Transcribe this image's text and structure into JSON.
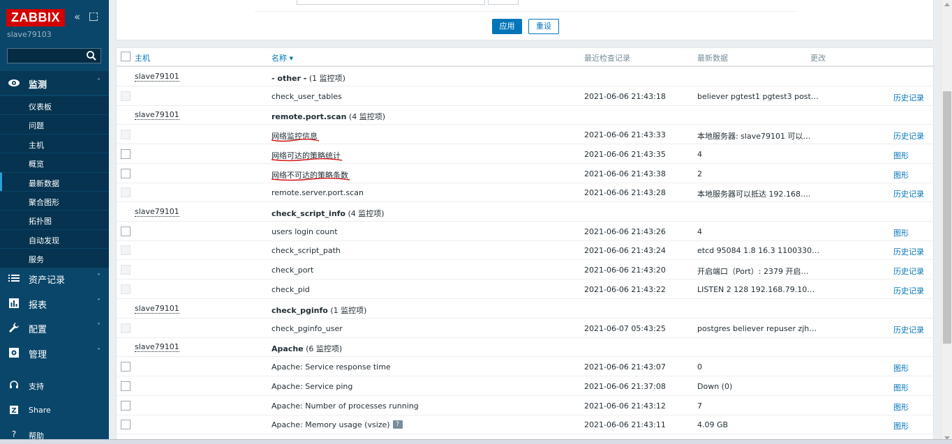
{
  "sidebar": {
    "logo": "ZABBIX",
    "server_name": "slave79103",
    "search_placeholder": "",
    "sections": [
      {
        "label": "监测",
        "icon": "eye-icon"
      },
      {
        "label": "资产记录",
        "icon": "list-icon"
      },
      {
        "label": "报表",
        "icon": "bar-chart-icon"
      },
      {
        "label": "配置",
        "icon": "wrench-icon"
      },
      {
        "label": "管理",
        "icon": "gear-icon"
      }
    ],
    "monitoring_items": [
      "仪表板",
      "问题",
      "主机",
      "概览",
      "最新数据",
      "聚合图形",
      "拓扑图",
      "自动发现",
      "服务"
    ],
    "selected_item": "最新数据",
    "footer": [
      {
        "label": "支持",
        "icon": "headset-icon"
      },
      {
        "label": "Share",
        "icon": "share-icon"
      },
      {
        "label": "帮助",
        "icon": "help-icon"
      }
    ]
  },
  "filter": {
    "apply_label": "应用",
    "reset_label": "重设"
  },
  "table": {
    "columns": {
      "host": "主机",
      "name": "名称 ▾",
      "last_check": "最近检查记录",
      "last_value": "最新数据",
      "change": "更改"
    },
    "rows": [
      {
        "type": "group",
        "host": "slave79101",
        "group_name": "- other -",
        "group_count": " (1 监控项)"
      },
      {
        "type": "item",
        "name": "check_user_tables",
        "last_check": "2021-06-06 21:43:18",
        "last_value": "believer pgtest1 pgtest3 post…",
        "link": "历史记录",
        "cb_disabled": true
      },
      {
        "type": "group",
        "host": "slave79101",
        "group_name": "remote.port.scan",
        "group_count": " (4 监控项)"
      },
      {
        "type": "item",
        "name": "网络监控信息",
        "last_check": "2021-06-06 21:43:33",
        "last_value": "本地服务器: slave79101 可以…",
        "link": "历史记录",
        "cb_disabled": true,
        "underline": true
      },
      {
        "type": "item",
        "name": "网络可达的策略统计",
        "last_check": "2021-06-06 21:43:35",
        "last_value": "4",
        "link": "图形",
        "cb_disabled": false,
        "underline": true
      },
      {
        "type": "item",
        "name": "网络不可达的策略条数",
        "last_check": "2021-06-06 21:43:38",
        "last_value": "2",
        "link": "图形",
        "cb_disabled": false,
        "underline": true
      },
      {
        "type": "item",
        "name": "remote.server.port.scan",
        "last_check": "2021-06-06 21:43:28",
        "last_value": "本地服务器可以抵达 192.168.…",
        "link": "历史记录",
        "cb_disabled": true
      },
      {
        "type": "group",
        "host": "slave79101",
        "group_name": "check_script_info",
        "group_count": " (4 监控项)"
      },
      {
        "type": "item",
        "name": "users login count",
        "last_check": "2021-06-06 21:43:26",
        "last_value": "4",
        "link": "图形",
        "cb_disabled": false
      },
      {
        "type": "item",
        "name": "check_script_path",
        "last_check": "2021-06-06 21:43:24",
        "last_value": "etcd 95084 1.8 16.3 1100330…",
        "link": "历史记录",
        "cb_disabled": true
      },
      {
        "type": "item",
        "name": "check_port",
        "last_check": "2021-06-06 21:43:20",
        "last_value": "开启端口（Port）: 2379 开启…",
        "link": "历史记录",
        "cb_disabled": true
      },
      {
        "type": "item",
        "name": "check_pid",
        "last_check": "2021-06-06 21:43:22",
        "last_value": "LISTEN 2 128 192.168.79.10…",
        "link": "历史记录",
        "cb_disabled": true
      },
      {
        "type": "group",
        "host": "slave79101",
        "group_name": "check_pginfo",
        "group_count": " (1 监控项)"
      },
      {
        "type": "item",
        "name": "check_pginfo_user",
        "last_check": "2021-06-07 05:43:25",
        "last_value": "postgres believer repuser zjh…",
        "link": "历史记录",
        "cb_disabled": true
      },
      {
        "type": "group",
        "host": "slave79101",
        "group_name": "Apache",
        "group_count": " (6 监控项)"
      },
      {
        "type": "item",
        "name": "Apache: Service response time",
        "last_check": "2021-06-06 21:43:07",
        "last_value": "0",
        "link": "图形",
        "cb_disabled": false
      },
      {
        "type": "item",
        "name": "Apache: Service ping",
        "last_check": "2021-06-06 21:37:08",
        "last_value": "Down (0)",
        "link": "图形",
        "cb_disabled": false
      },
      {
        "type": "item",
        "name": "Apache: Number of processes running",
        "last_check": "2021-06-06 21:43:12",
        "last_value": "7",
        "link": "图形",
        "cb_disabled": false
      },
      {
        "type": "item",
        "name": "Apache: Memory usage (vsize)",
        "last_check": "2021-06-06 21:43:11",
        "last_value": "4.09 GB",
        "link": "图形",
        "cb_disabled": false,
        "help": "?"
      }
    ]
  }
}
